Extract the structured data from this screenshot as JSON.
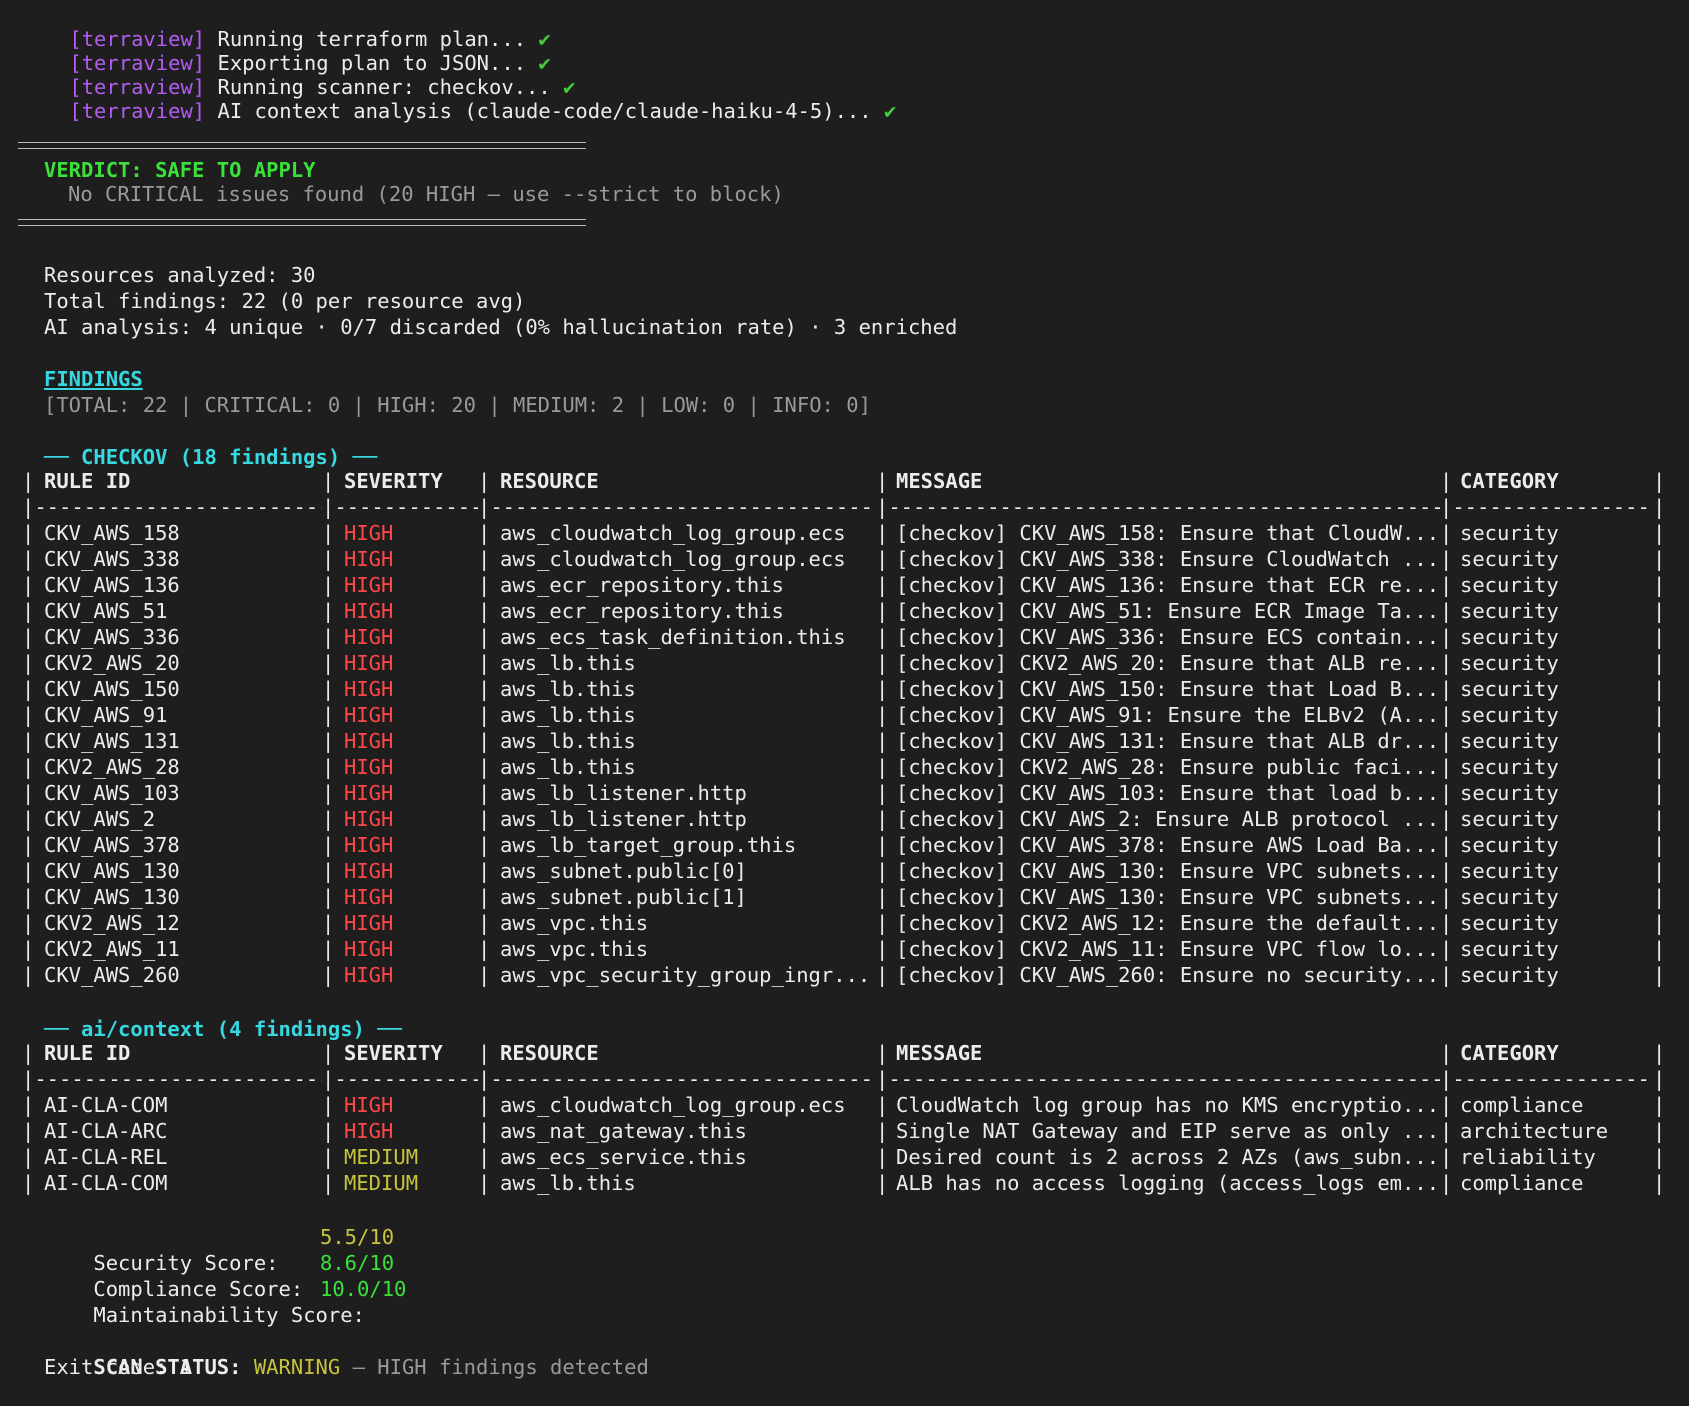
{
  "log": [
    {
      "tag": "[terraview]",
      "text": "Running terraform plan...",
      "check": "✔"
    },
    {
      "tag": "[terraview]",
      "text": "Exporting plan to JSON...",
      "check": "✔"
    },
    {
      "tag": "[terraview]",
      "text": "Running scanner: checkov...",
      "check": "✔"
    },
    {
      "tag": "[terraview]",
      "text": "AI context analysis (claude-code/claude-haiku-4-5)...",
      "check": "✔"
    }
  ],
  "verdict": {
    "title": "VERDICT: SAFE TO APPLY",
    "detail": "No CRITICAL issues found (20 HIGH — use --strict to block)"
  },
  "stats": {
    "resources": "Resources analyzed: 30",
    "findings": "Total findings: 22 (0 per resource avg)",
    "ai": "AI analysis: 4 unique · 0/7 discarded (0% hallucination rate) · 3 enriched"
  },
  "findings_header": {
    "title": "FINDINGS",
    "summary": "[TOTAL: 22 | CRITICAL: 0 | HIGH: 20 | MEDIUM: 2 | LOW: 0 | INFO: 0]"
  },
  "columns": [
    "RULE ID",
    "SEVERITY",
    "RESOURCE",
    "MESSAGE",
    "CATEGORY"
  ],
  "checkov": {
    "title": "── CHECKOV (18 findings) ──",
    "rows": [
      [
        "CKV_AWS_158",
        "HIGH",
        "aws_cloudwatch_log_group.ecs",
        "[checkov] CKV_AWS_158: Ensure that CloudW...",
        "security"
      ],
      [
        "CKV_AWS_338",
        "HIGH",
        "aws_cloudwatch_log_group.ecs",
        "[checkov] CKV_AWS_338: Ensure CloudWatch ...",
        "security"
      ],
      [
        "CKV_AWS_136",
        "HIGH",
        "aws_ecr_repository.this",
        "[checkov] CKV_AWS_136: Ensure that ECR re...",
        "security"
      ],
      [
        "CKV_AWS_51",
        "HIGH",
        "aws_ecr_repository.this",
        "[checkov] CKV_AWS_51: Ensure ECR Image Ta...",
        "security"
      ],
      [
        "CKV_AWS_336",
        "HIGH",
        "aws_ecs_task_definition.this",
        "[checkov] CKV_AWS_336: Ensure ECS contain...",
        "security"
      ],
      [
        "CKV2_AWS_20",
        "HIGH",
        "aws_lb.this",
        "[checkov] CKV2_AWS_20: Ensure that ALB re...",
        "security"
      ],
      [
        "CKV_AWS_150",
        "HIGH",
        "aws_lb.this",
        "[checkov] CKV_AWS_150: Ensure that Load B...",
        "security"
      ],
      [
        "CKV_AWS_91",
        "HIGH",
        "aws_lb.this",
        "[checkov] CKV_AWS_91: Ensure the ELBv2 (A...",
        "security"
      ],
      [
        "CKV_AWS_131",
        "HIGH",
        "aws_lb.this",
        "[checkov] CKV_AWS_131: Ensure that ALB dr...",
        "security"
      ],
      [
        "CKV2_AWS_28",
        "HIGH",
        "aws_lb.this",
        "[checkov] CKV2_AWS_28: Ensure public faci...",
        "security"
      ],
      [
        "CKV_AWS_103",
        "HIGH",
        "aws_lb_listener.http",
        "[checkov] CKV_AWS_103: Ensure that load b...",
        "security"
      ],
      [
        "CKV_AWS_2",
        "HIGH",
        "aws_lb_listener.http",
        "[checkov] CKV_AWS_2: Ensure ALB protocol ...",
        "security"
      ],
      [
        "CKV_AWS_378",
        "HIGH",
        "aws_lb_target_group.this",
        "[checkov] CKV_AWS_378: Ensure AWS Load Ba...",
        "security"
      ],
      [
        "CKV_AWS_130",
        "HIGH",
        "aws_subnet.public[0]",
        "[checkov] CKV_AWS_130: Ensure VPC subnets...",
        "security"
      ],
      [
        "CKV_AWS_130",
        "HIGH",
        "aws_subnet.public[1]",
        "[checkov] CKV_AWS_130: Ensure VPC subnets...",
        "security"
      ],
      [
        "CKV2_AWS_12",
        "HIGH",
        "aws_vpc.this",
        "[checkov] CKV2_AWS_12: Ensure the default...",
        "security"
      ],
      [
        "CKV2_AWS_11",
        "HIGH",
        "aws_vpc.this",
        "[checkov] CKV2_AWS_11: Ensure VPC flow lo...",
        "security"
      ],
      [
        "CKV_AWS_260",
        "HIGH",
        "aws_vpc_security_group_ingr...",
        "[checkov] CKV_AWS_260: Ensure no security...",
        "security"
      ]
    ]
  },
  "ai_context": {
    "title": "── ai/context (4 findings) ──",
    "rows": [
      [
        "AI-CLA-COM",
        "HIGH",
        "aws_cloudwatch_log_group.ecs",
        "CloudWatch log group has no KMS encryptio...",
        "compliance"
      ],
      [
        "AI-CLA-ARC",
        "HIGH",
        "aws_nat_gateway.this",
        "Single NAT Gateway and EIP serve as only ...",
        "architecture"
      ],
      [
        "AI-CLA-REL",
        "MEDIUM",
        "aws_ecs_service.this",
        "Desired count is 2 across 2 AZs (aws_subn...",
        "reliability"
      ],
      [
        "AI-CLA-COM",
        "MEDIUM",
        "aws_lb.this",
        "ALB has no access logging (access_logs em...",
        "compliance"
      ]
    ]
  },
  "scores": [
    {
      "label": "Security Score:",
      "value": "5.5/10",
      "color": "#c7c43c"
    },
    {
      "label": "Compliance Score:",
      "value": "8.6/10",
      "color": "#3be03b"
    },
    {
      "label": "Maintainability Score:",
      "value": "10.0/10",
      "color": "#3be03b"
    }
  ],
  "scan_status": {
    "label": "SCAN STATUS:",
    "status": "WARNING",
    "detail": "— HIGH findings detected",
    "exit": "Exit code: 1"
  },
  "colors": {
    "tag": "#b45cf0",
    "check": "#3fcf3f",
    "high": "#ff4747",
    "medium": "#c7c43c",
    "cyan": "#37d8e0",
    "background": "#1e1e1e"
  }
}
